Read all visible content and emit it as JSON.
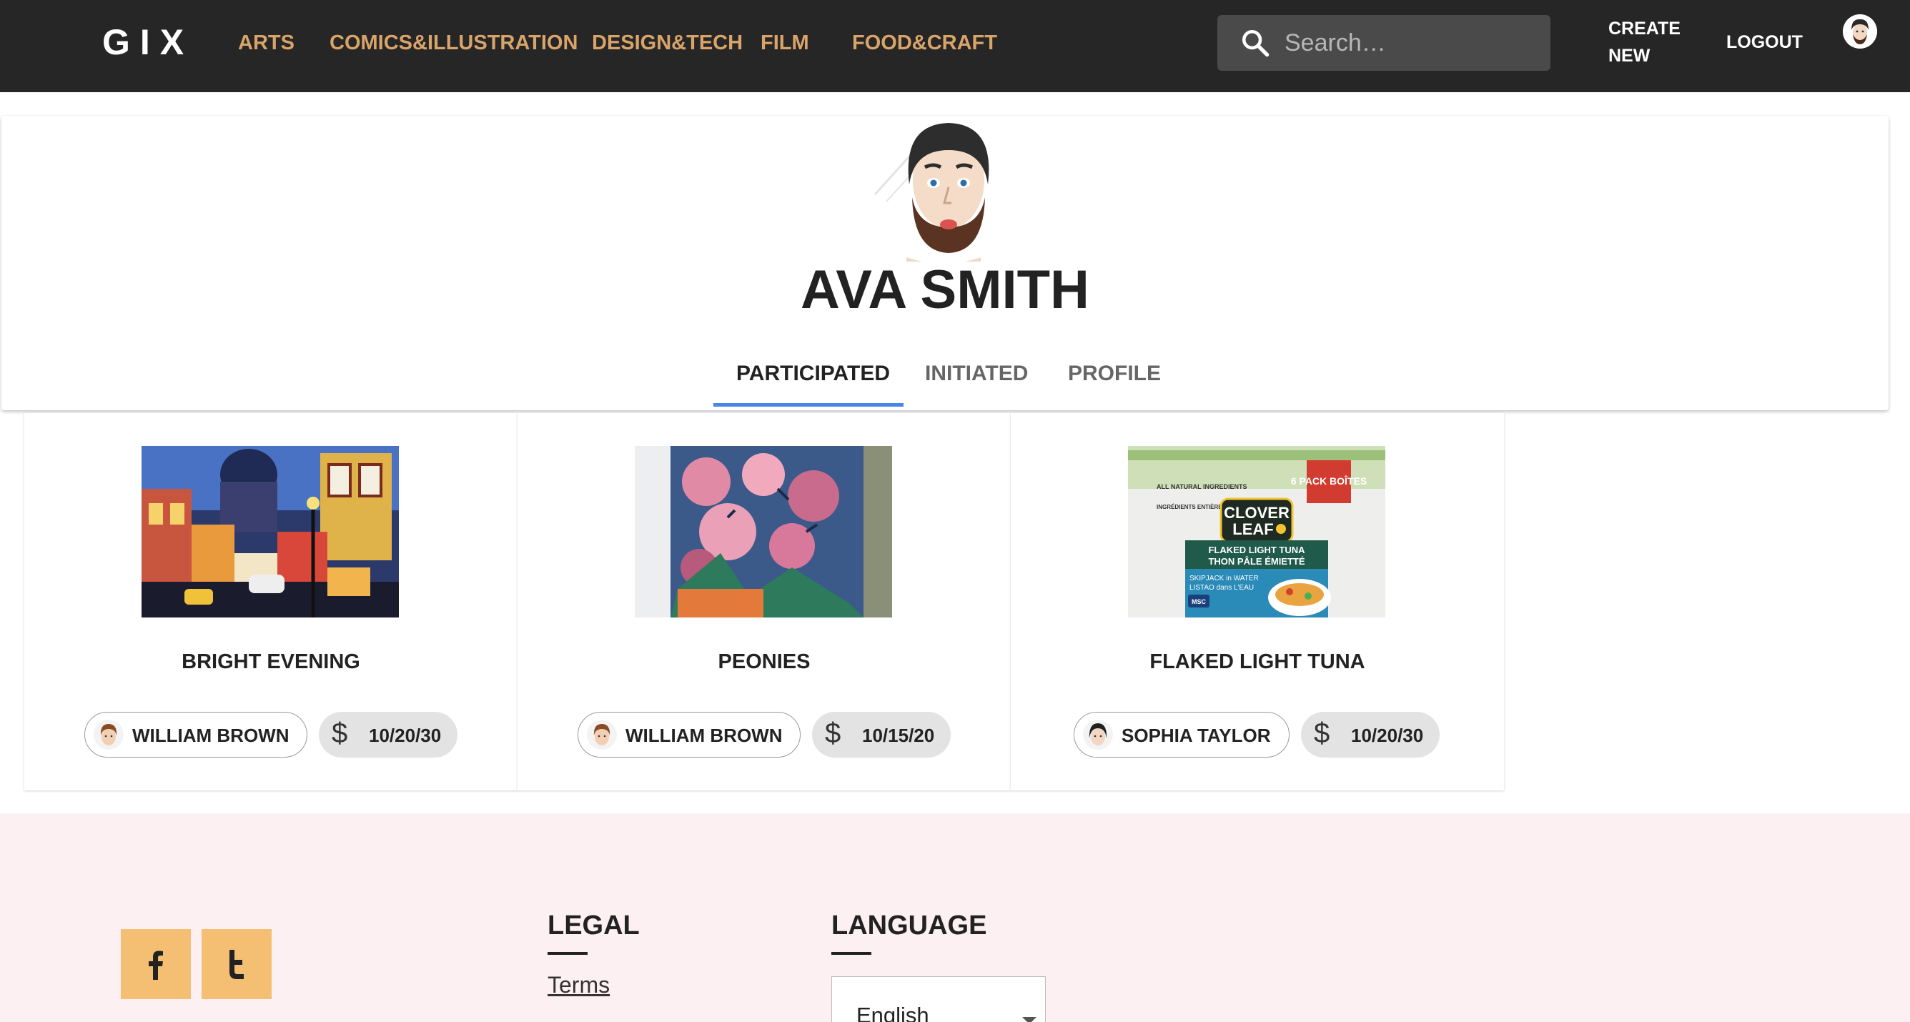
{
  "header": {
    "logo": "GIX",
    "nav": [
      "ARTS",
      "COMICS&ILLUSTRATION",
      "DESIGN&TECH",
      "FILM",
      "FOOD&CRAFT"
    ],
    "search_placeholder": "Search…",
    "create_line1": "CREATE",
    "create_line2": "NEW",
    "logout": "LOGOUT"
  },
  "profile": {
    "name": "AVA SMITH",
    "tabs": [
      "PARTICIPATED",
      "INITIATED",
      "PROFILE"
    ],
    "active_tab": "PARTICIPATED"
  },
  "projects": [
    {
      "title": "BRIGHT EVENING",
      "user": "WILLIAM BROWN",
      "date": "10/20/30"
    },
    {
      "title": "PEONIES",
      "user": "WILLIAM BROWN",
      "date": "10/15/20"
    },
    {
      "title": "FLAKED LIGHT TUNA",
      "user": "SOPHIA TAYLOR",
      "date": "10/20/30"
    }
  ],
  "price_symbol": "$",
  "tuna_label": {
    "brand_line1": "CLOVER",
    "brand_line2": "LEAF",
    "pack": "6 PACK BOÎTES",
    "product_en": "FLAKED LIGHT TUNA",
    "product_fr": "THON PÂLE ÉMIETTÉ",
    "water_en": "SKIPJACK in WATER",
    "water_fr": "LISTAO dans L'EAU",
    "ingredients_en": "ALL NATURAL INGREDIENTS",
    "ingredients_fr": "INGRÉDIENTS ENTIÈREMENT NATURELS",
    "msc": "MSC"
  },
  "footer": {
    "legal_heading": "LEGAL",
    "terms": "Terms",
    "language_heading": "LANGUAGE",
    "language_value": "English"
  },
  "colors": {
    "header_bg": "#262626",
    "nav_text": "#d9a46a",
    "tab_accent": "#4a86e8",
    "footer_bg": "#fdf0f3",
    "social_bg": "#f5bf73"
  }
}
